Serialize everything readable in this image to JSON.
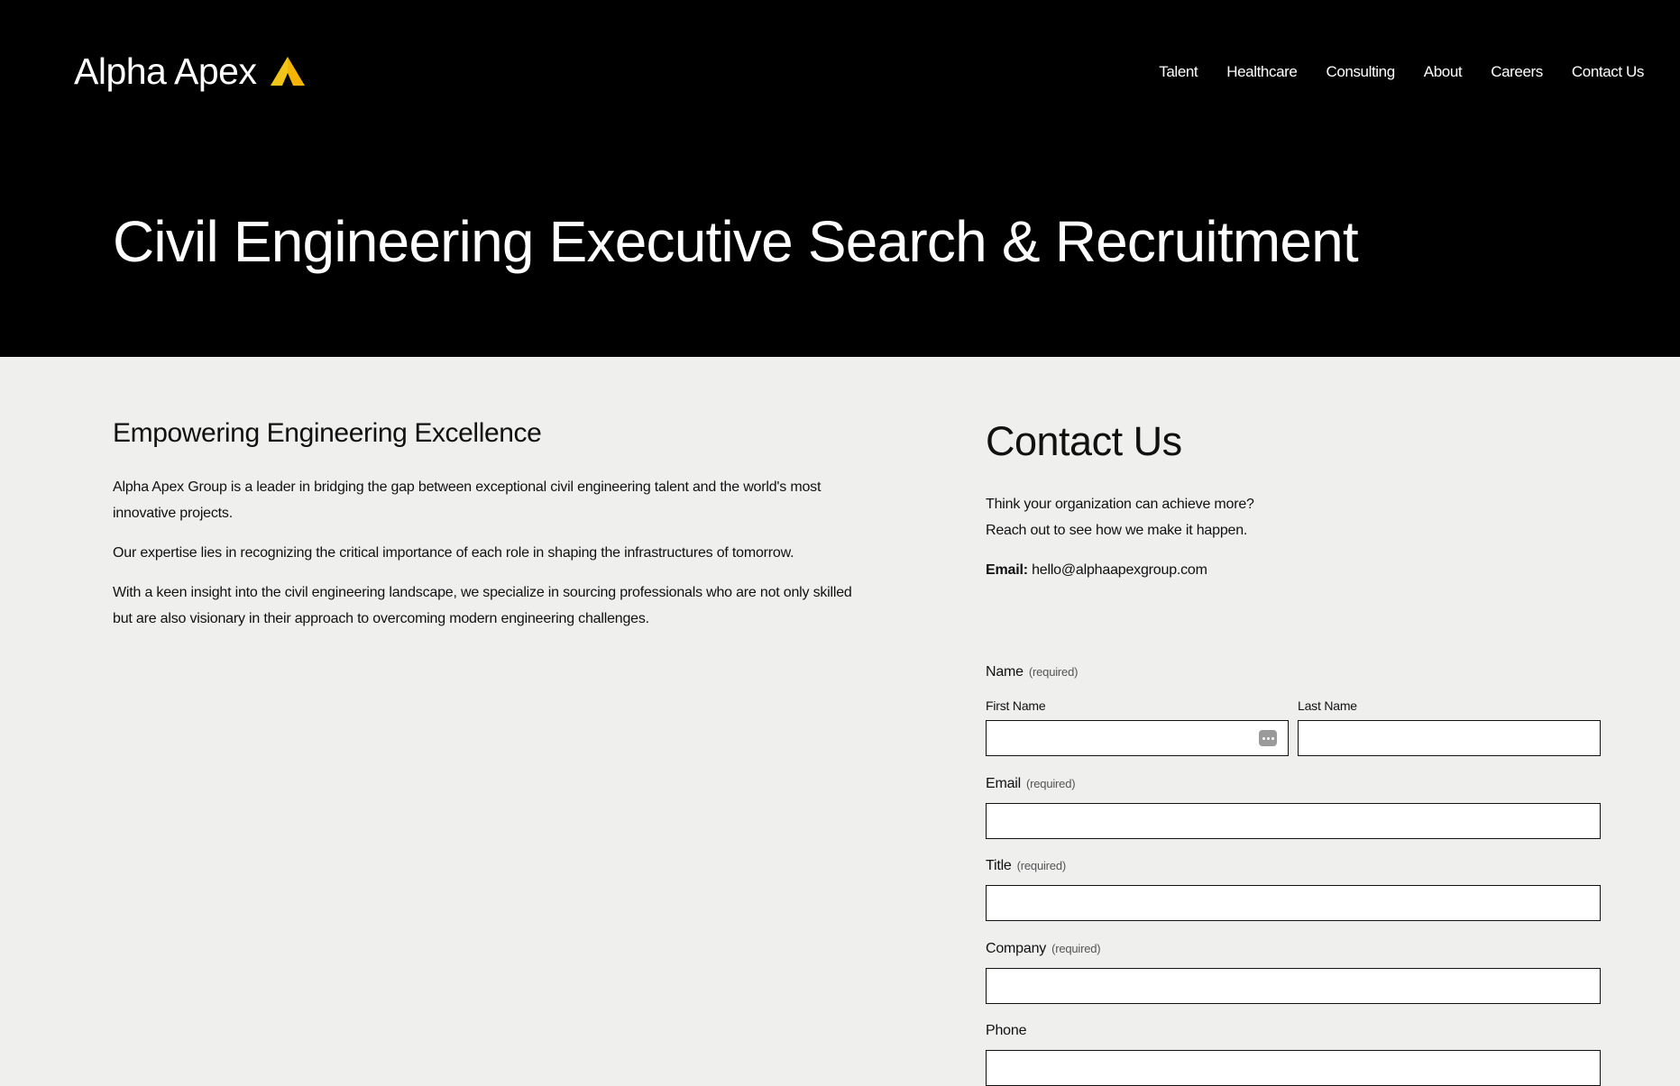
{
  "brand": {
    "name": "Alpha Apex",
    "accent_color": "#f5b400"
  },
  "nav": {
    "items": [
      {
        "label": "Talent"
      },
      {
        "label": "Healthcare"
      },
      {
        "label": "Consulting"
      },
      {
        "label": "About"
      },
      {
        "label": "Careers"
      },
      {
        "label": "Contact Us"
      }
    ]
  },
  "hero": {
    "title": "Civil Engineering Executive Search & Recruitment"
  },
  "intro": {
    "heading": "Empowering Engineering Excellence",
    "paragraphs": [
      "Alpha Apex Group is a leader in bridging the gap between exceptional civil engineering talent and the world's most innovative projects.",
      "Our expertise lies in recognizing the critical importance of each role in shaping the infrastructures of tomorrow.",
      "With a keen insight into the civil engineering landscape, we specialize in sourcing professionals who are not only skilled but are also visionary in their approach to overcoming modern engineering challenges."
    ]
  },
  "contact": {
    "title": "Contact Us",
    "line1": "Think your organization can achieve more?",
    "line2": "Reach out to see how we make it happen.",
    "email_label": "Email:",
    "email_value": "hello@alphaapexgroup.com"
  },
  "form": {
    "required_text": "(required)",
    "name_label": "Name",
    "first_name_label": "First Name",
    "last_name_label": "Last Name",
    "first_name_value": "",
    "last_name_value": "",
    "email_label": "Email",
    "email_value": "",
    "title_label": "Title",
    "title_value": "",
    "company_label": "Company",
    "company_value": "",
    "phone_label": "Phone",
    "phone_value": "",
    "autofill_icon": "autofill-icon"
  }
}
